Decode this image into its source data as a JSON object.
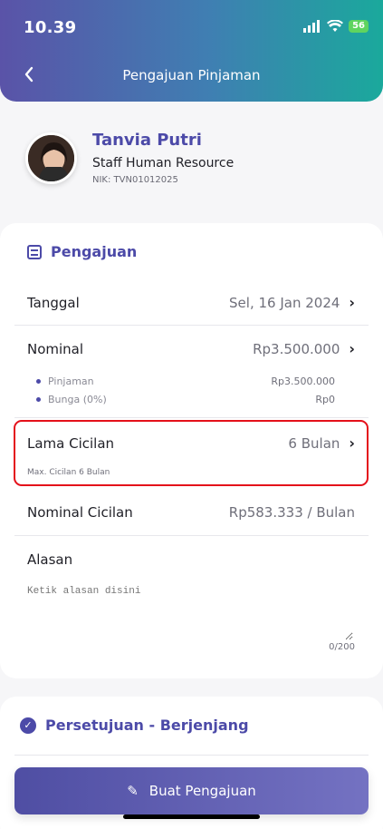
{
  "status_bar": {
    "time": "10.39",
    "battery": "56"
  },
  "header": {
    "title": "Pengajuan Pinjaman"
  },
  "profile": {
    "name": "Tanvia Putri",
    "role": "Staff Human Resource",
    "nik": "NIK: TVN01012025"
  },
  "pengajuan": {
    "section_title": "Pengajuan",
    "tanggal_label": "Tanggal",
    "tanggal_value": "Sel, 16 Jan 2024",
    "nominal_label": "Nominal",
    "nominal_value": "Rp3.500.000",
    "pinjaman_label": "Pinjaman",
    "pinjaman_value": "Rp3.500.000",
    "bunga_label": "Bunga (0%)",
    "bunga_value": "Rp0",
    "lama_label": "Lama Cicilan",
    "lama_value": "6 Bulan",
    "max_note": "Max. Cicilan 6 Bulan",
    "nominal_cicilan_label": "Nominal Cicilan",
    "nominal_cicilan_value": "Rp583.333 / Bulan",
    "alasan_label": "Alasan",
    "alasan_placeholder": "Ketik alasan disini",
    "alasan_count": "0/200"
  },
  "approval": {
    "title": "Persetujuan - Berjenjang"
  },
  "submit": {
    "label": "Buat Pengajuan"
  },
  "colors": {
    "accent": "#4c4aa8",
    "highlight": "#e4101a"
  }
}
